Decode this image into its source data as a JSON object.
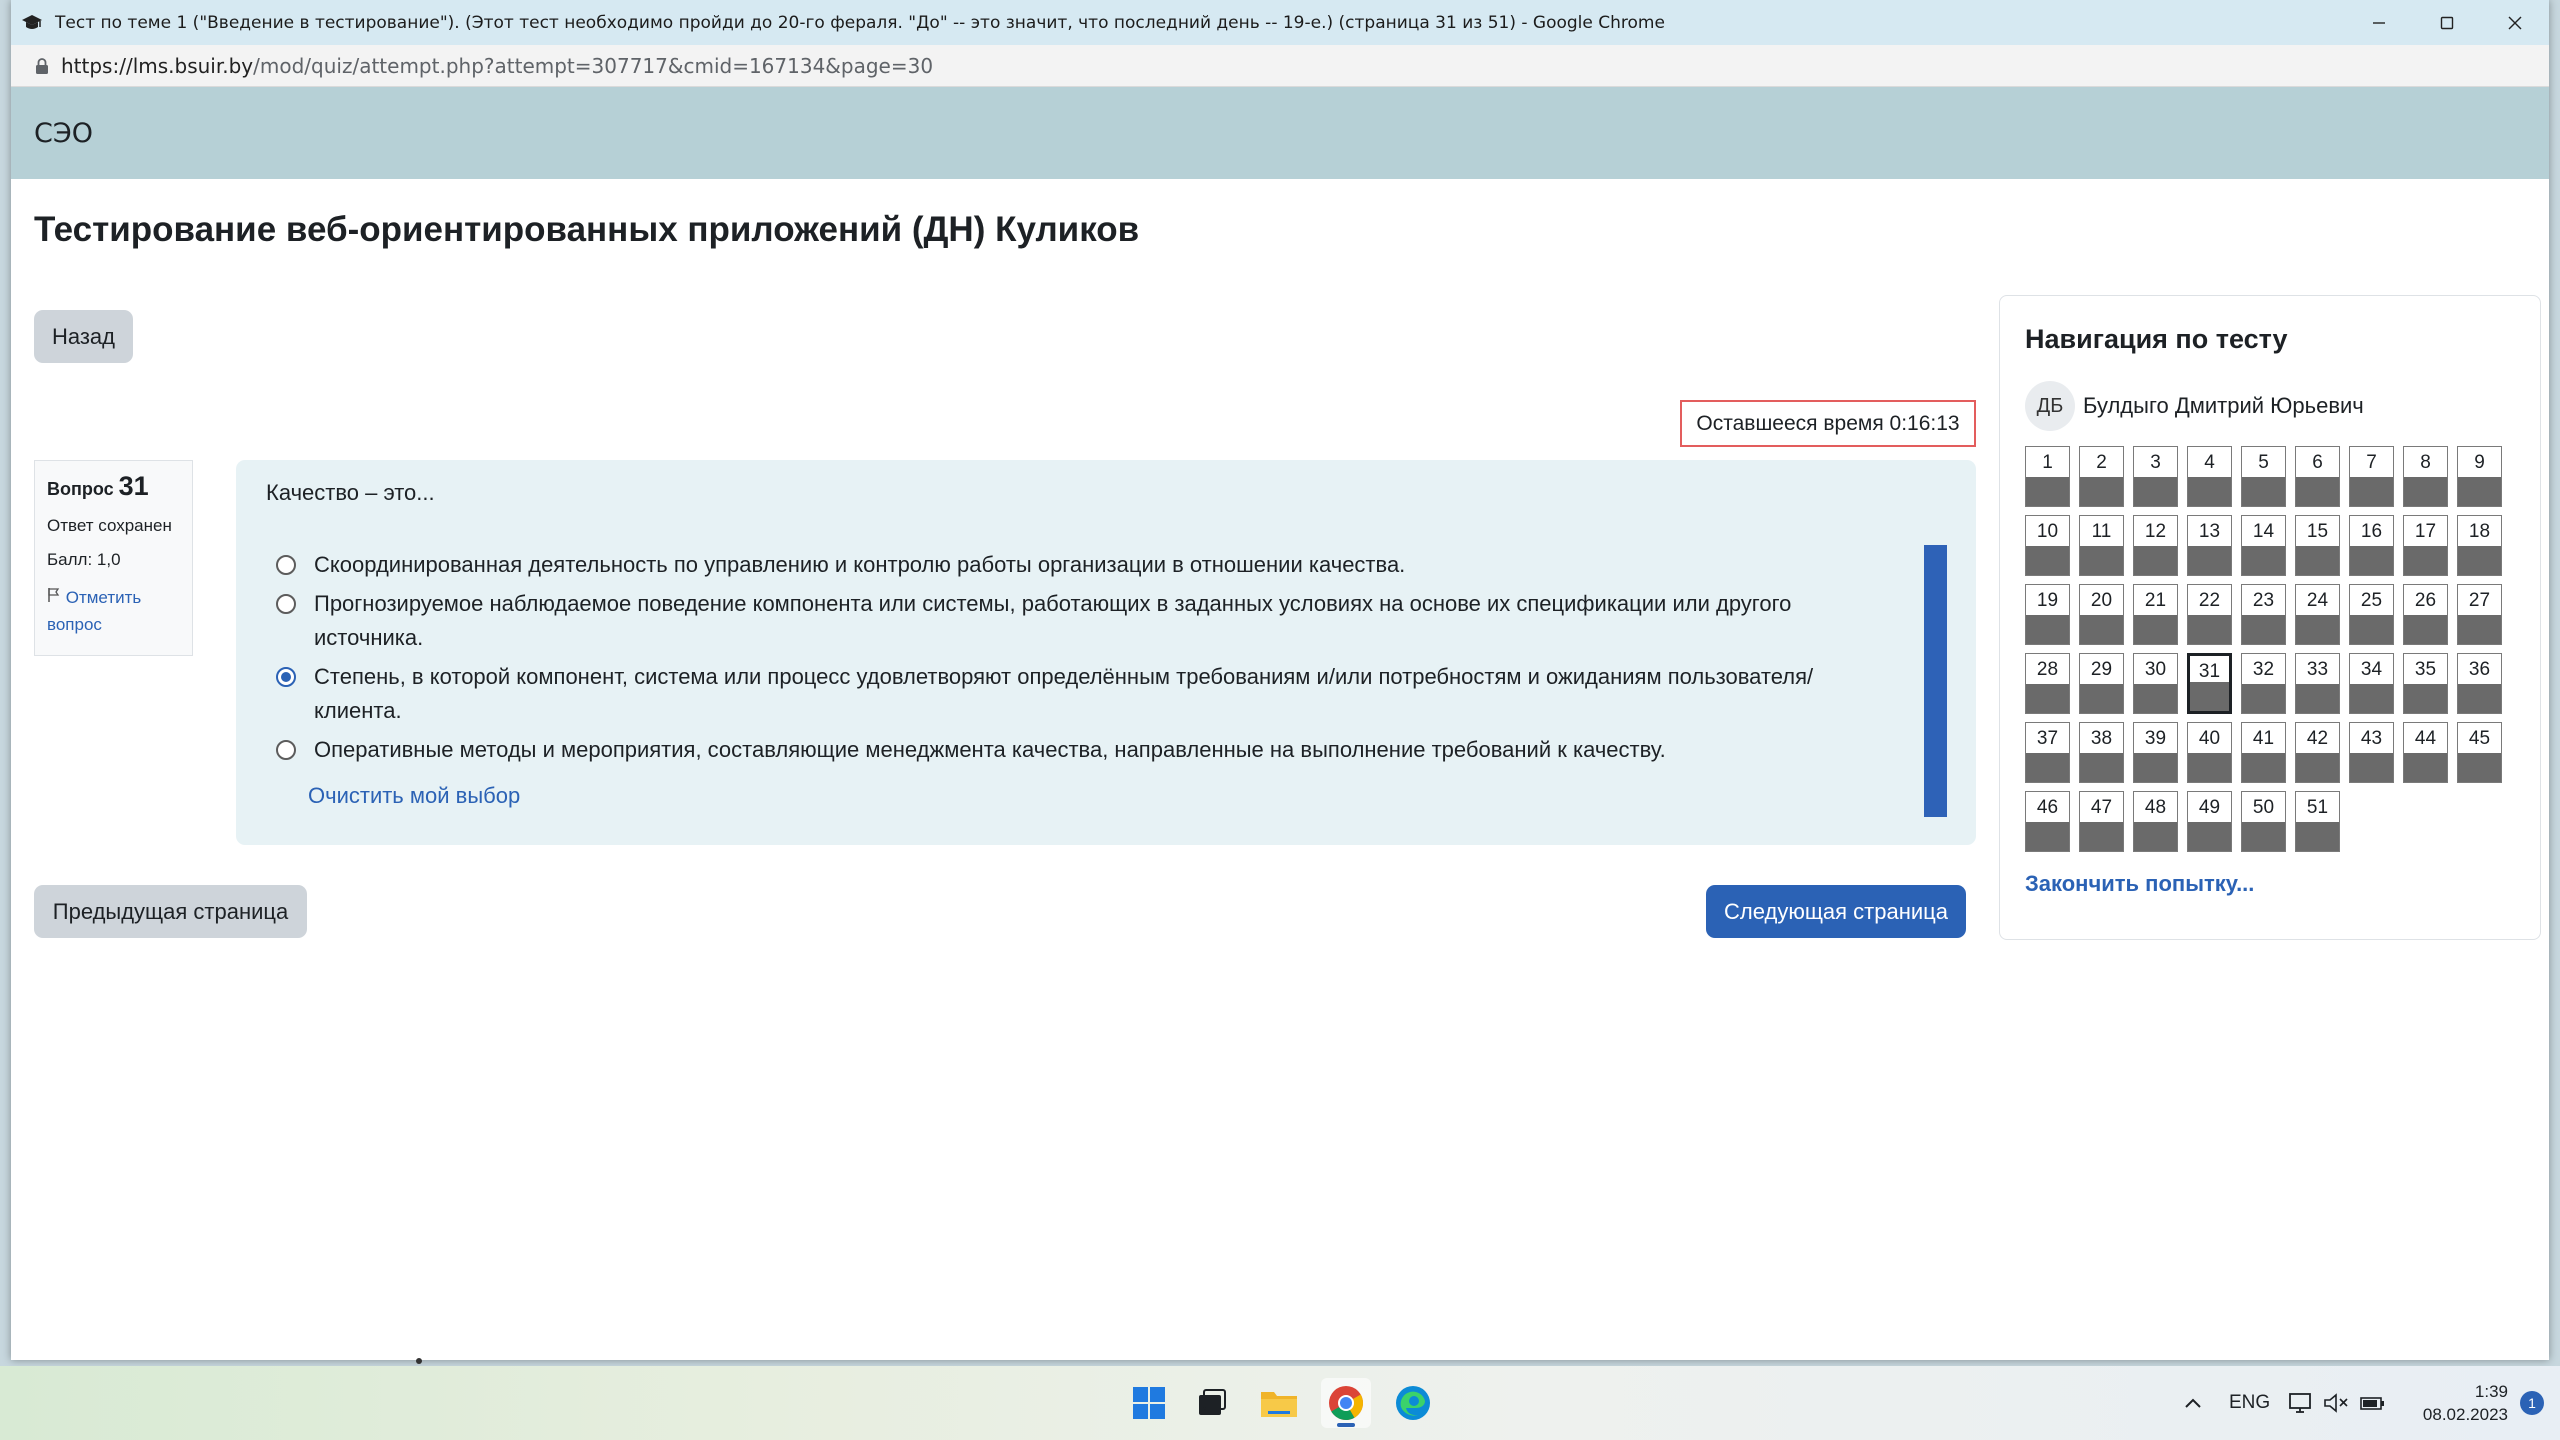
{
  "browser": {
    "window_title": "Тест по теме 1 (\"Введение в тестирование\"). (Этот тест необходимо пройди до 20-го фераля. \"До\" -- это значит, что последний день -- 19-е.) (страница 31 из 51) - Google Chrome",
    "url_host": "https://lms.bsuir.by",
    "url_path": "/mod/quiz/attempt.php?attempt=307717&cmid=167134&page=30",
    "icons": [
      "mortarboard-icon",
      "lock-icon",
      "minimize-icon",
      "maximize-icon",
      "close-icon"
    ]
  },
  "site": {
    "brand": "СЭО"
  },
  "page": {
    "title": "Тестирование веб-ориентированных приложений (ДН) Куликов",
    "back_button": "Назад",
    "timer": "Оставшееся время 0:16:13"
  },
  "question": {
    "label": "Вопрос",
    "number": "31",
    "status": "Ответ сохранен",
    "grade": "Балл: 1,0",
    "flag_line1": "Отметить",
    "flag_line2": "вопрос",
    "text": "Качество – это...",
    "answers": [
      {
        "text": "Скоординированная деятельность по управлению и контролю работы организации в отношении качества.",
        "selected": false
      },
      {
        "text": "Прогнозируемое наблюдаемое поведение компонента или системы, работающих в заданных условиях на основе их спецификации или другого источника.",
        "selected": false
      },
      {
        "text": "Степень, в которой компонент, система или процесс удовлетворяют определённым требованиям и/или потребностям и ожиданиям пользователя/клиента.",
        "selected": true
      },
      {
        "text": "Оперативные методы и мероприятия, составляющие менеджмента качества, направленные на выполнение требований к качеству.",
        "selected": false
      }
    ],
    "clear_choice": "Очистить мой выбор"
  },
  "footer_nav": {
    "prev": "Предыдущая страница",
    "next": "Следующая страница"
  },
  "quiz_nav": {
    "title": "Навигация по тесту",
    "avatar_initials": "ДБ",
    "user_name": "Булдыго Дмитрий Юрьевич",
    "questions": [
      "1",
      "2",
      "3",
      "4",
      "5",
      "6",
      "7",
      "8",
      "9",
      "10",
      "11",
      "12",
      "13",
      "14",
      "15",
      "16",
      "17",
      "18",
      "19",
      "20",
      "21",
      "22",
      "23",
      "24",
      "25",
      "26",
      "27",
      "28",
      "29",
      "30",
      "31",
      "32",
      "33",
      "34",
      "35",
      "36",
      "37",
      "38",
      "39",
      "40",
      "41",
      "42",
      "43",
      "44",
      "45",
      "46",
      "47",
      "48",
      "49",
      "50",
      "51"
    ],
    "current": "31",
    "finish": "Закончить попытку..."
  },
  "taskbar": {
    "apps": [
      "windows-start-icon",
      "task-view-icon",
      "file-explorer-icon",
      "chrome-icon",
      "edge-icon"
    ],
    "active_app": "chrome-icon",
    "language": "ENG",
    "time": "1:39",
    "date": "08.02.2023",
    "notifications": "1"
  },
  "colors": {
    "accent": "#2b62b5",
    "navbar": "#b6d0d6",
    "question_bg": "#e7f2f5",
    "timer_border": "#e35d5d"
  }
}
